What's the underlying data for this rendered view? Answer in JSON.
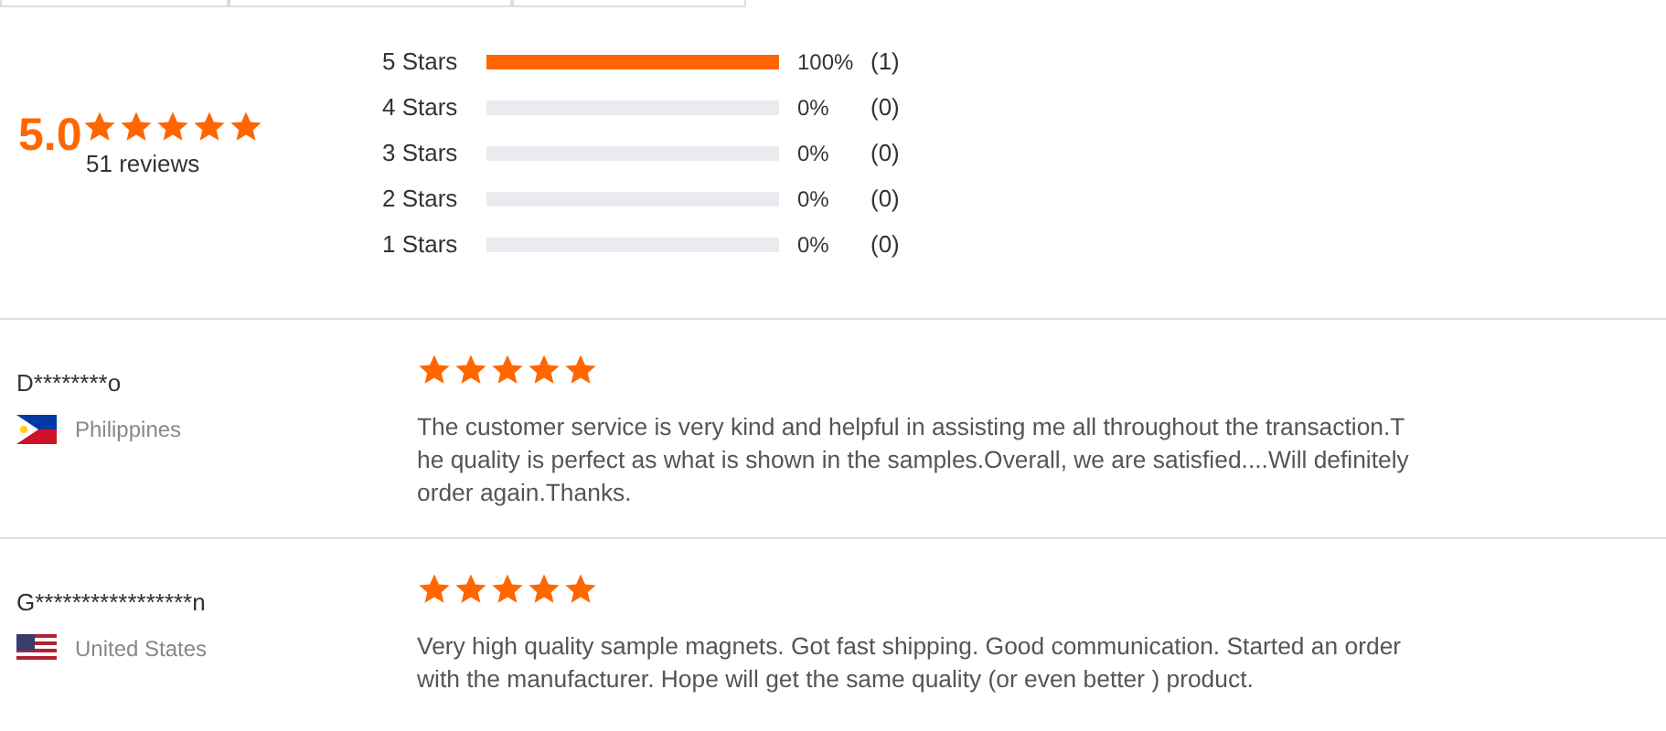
{
  "summary": {
    "score": "5.0",
    "stars": 5,
    "reviews": "51 reviews"
  },
  "breakdown": [
    {
      "label": "5 Stars",
      "level": 1,
      "percent": "100%",
      "count": "(1)"
    },
    {
      "label": "4 Stars",
      "level": 0,
      "percent": "0%",
      "count": "(0)"
    },
    {
      "label": "3 Stars",
      "level": 0,
      "percent": "0%",
      "count": "(0)"
    },
    {
      "label": "2 Stars",
      "level": 0,
      "percent": "0%",
      "count": "(0)"
    },
    {
      "label": "1 Stars",
      "level": 0,
      "percent": "0%",
      "count": "(0)"
    }
  ],
  "reviews": [
    {
      "name": "D********o",
      "kind": "ph",
      "country": "Philippines",
      "stars": 5,
      "lines": [
        "The customer service is very kind and helpful in assisting me all throughout the transaction.T",
        "he quality is perfect as what is shown in the samples.Overall, we are satisfied....Will definitely",
        "order again.Thanks."
      ]
    },
    {
      "name": "G*****************n",
      "kind": "us",
      "country": "United States",
      "stars": 5,
      "lines": [
        "Very high quality sample magnets. Got fast shipping. Good communication. Started an order",
        "with the manufacturer. Hope will get the same quality (or even better ) product."
      ]
    }
  ]
}
